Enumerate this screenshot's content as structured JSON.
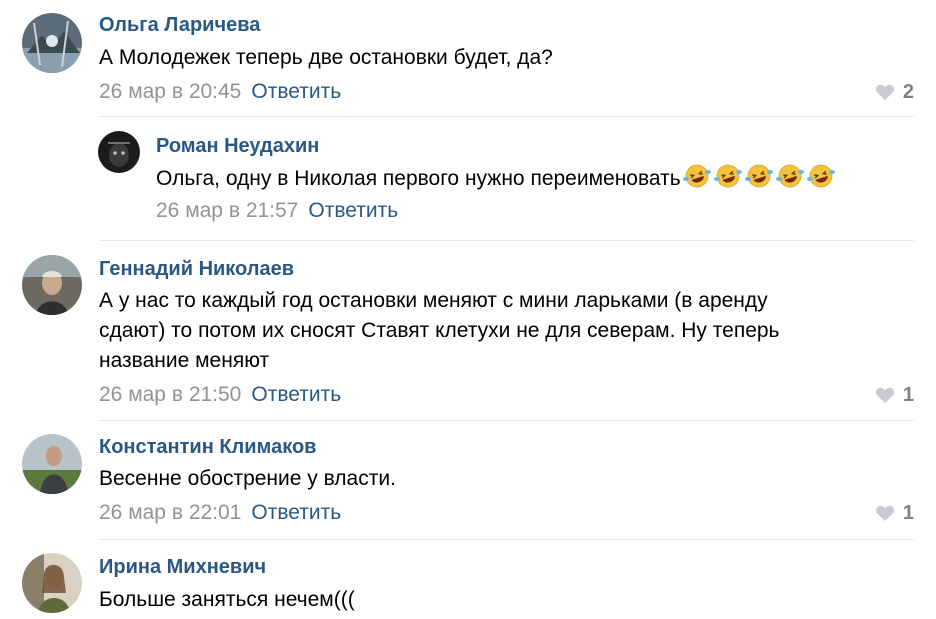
{
  "comments": [
    {
      "author": "Ольга Ларичева",
      "text": "А Молодежек теперь две остановки будет, да?",
      "date": "26 мар в 20:45",
      "reply_label": "Ответить",
      "likes": "2"
    },
    {
      "author": "Роман Неудахин",
      "text": "Ольга, одну в Николая первого нужно переименовать",
      "emoji": "rolling-on-floor-laughing-icon",
      "emoji_count": 5,
      "date": "26 мар в 21:57",
      "reply_label": "Ответить"
    },
    {
      "author": "Геннадий Николаев",
      "text_lines": [
        "А у нас то каждый год остановки меняют с мини ларьками (в аренду",
        "сдают) то потом их сносят Ставят клетухи не для северам. Ну теперь",
        "название меняют"
      ],
      "date": "26 мар в 21:50",
      "reply_label": "Ответить",
      "likes": "1"
    },
    {
      "author": "Константин Климаков",
      "text": "Весенне обострение у власти.",
      "date": "26 мар в 22:01",
      "reply_label": "Ответить",
      "likes": "1"
    },
    {
      "author": "Ирина Михневич",
      "text": "Больше заняться нечем((("
    }
  ],
  "colors": {
    "author": "#2a5885",
    "date": "#939393",
    "like": "#828282",
    "divider": "#e7e8ec"
  }
}
